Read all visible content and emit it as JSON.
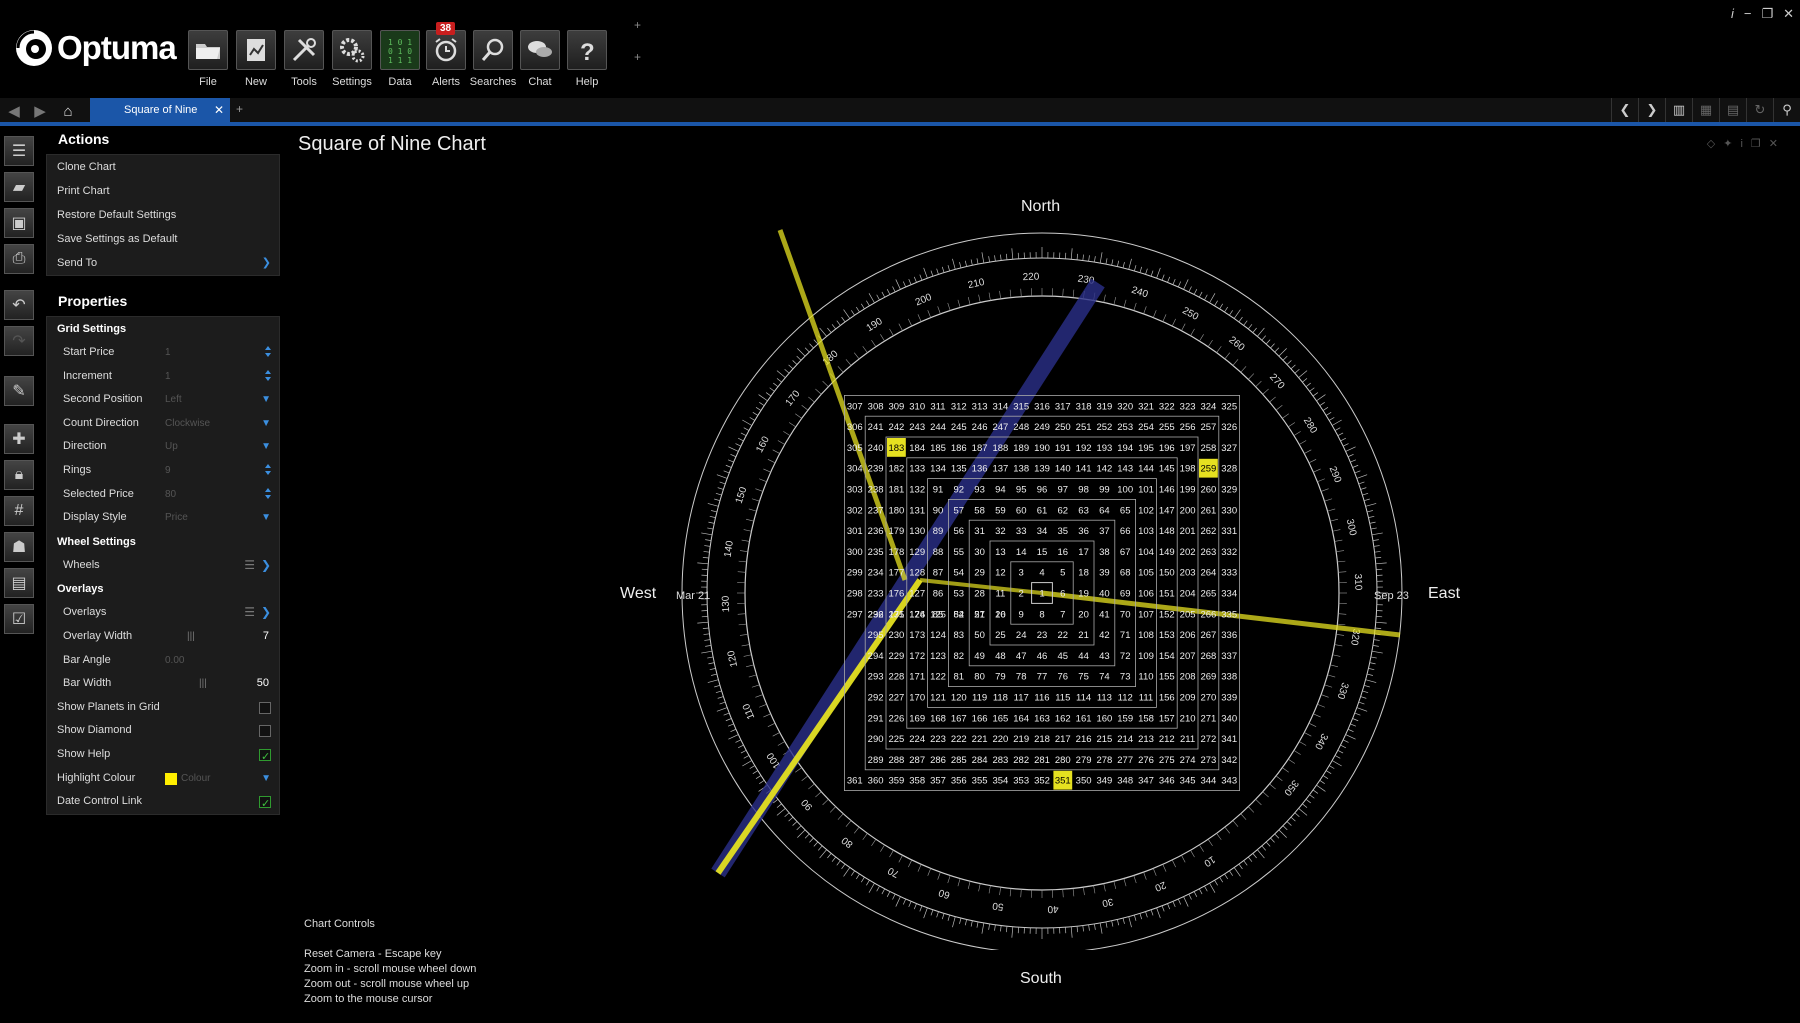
{
  "app": {
    "brand": "Optuma",
    "toolbar": [
      {
        "label": "File",
        "icon": "folder-icon"
      },
      {
        "label": "New",
        "icon": "new-chart-icon"
      },
      {
        "label": "Tools",
        "icon": "tools-icon"
      },
      {
        "label": "Settings",
        "icon": "gears-icon"
      },
      {
        "label": "Data",
        "icon": "data-icon"
      },
      {
        "label": "Alerts",
        "icon": "alarm-clock-icon"
      },
      {
        "label": "Searches",
        "icon": "magnifier-icon"
      },
      {
        "label": "Chat",
        "icon": "chat-bubbles-icon"
      },
      {
        "label": "Help",
        "icon": "question-icon"
      }
    ],
    "alerts_count": "38"
  },
  "tabs": [
    {
      "label": "Square of Nine",
      "active": true
    }
  ],
  "panel": {
    "actions_title": "Actions",
    "actions": [
      "Clone Chart",
      "Print Chart",
      "Restore Default Settings",
      "Save Settings as Default",
      "Send To"
    ],
    "properties_title": "Properties",
    "grid_settings": "Grid Settings",
    "start_price": {
      "label": "Start Price",
      "value": "1"
    },
    "increment": {
      "label": "Increment",
      "value": "1"
    },
    "second_position": {
      "label": "Second Position",
      "value": "Left"
    },
    "count_direction": {
      "label": "Count Direction",
      "value": "Clockwise"
    },
    "direction": {
      "label": "Direction",
      "value": "Up"
    },
    "rings": {
      "label": "Rings",
      "value": "9"
    },
    "selected_price": {
      "label": "Selected Price",
      "value": "80"
    },
    "display_style": {
      "label": "Display Style",
      "value": "Price"
    },
    "wheel_settings": "Wheel Settings",
    "wheels": {
      "label": "Wheels"
    },
    "overlays_group": "Overlays",
    "overlays": {
      "label": "Overlays"
    },
    "overlay_width": {
      "label": "Overlay Width",
      "value": "7"
    },
    "bar_angle": {
      "label": "Bar Angle",
      "value": "0.00"
    },
    "bar_width": {
      "label": "Bar Width",
      "value": "50"
    },
    "show_planets": {
      "label": "Show Planets in Grid",
      "checked": false
    },
    "show_diamond": {
      "label": "Show Diamond",
      "checked": false
    },
    "show_help": {
      "label": "Show Help",
      "checked": true
    },
    "highlight_colour": {
      "label": "Highlight Colour",
      "value": "Colour",
      "color": "#ffee00"
    },
    "date_control_link": {
      "label": "Date Control Link",
      "checked": true
    }
  },
  "chart": {
    "title": "Square of Nine Chart",
    "north": "North",
    "south": "South",
    "east": "East",
    "west": "West",
    "degree_labels": [
      "10",
      "20",
      "30",
      "40",
      "50",
      "60",
      "70",
      "80",
      "90",
      "100",
      "110",
      "120",
      "130",
      "140",
      "150",
      "160",
      "170",
      "180",
      "190",
      "200",
      "210",
      "220",
      "230",
      "240",
      "250",
      "260",
      "270",
      "280",
      "290",
      "300",
      "310",
      "320",
      "330",
      "340",
      "350"
    ],
    "date_labels": {
      "mar": "Mar 21",
      "sep": "Sep 23"
    },
    "grid_highlights": [
      183,
      259,
      351
    ],
    "highlight_color": "#e5e020",
    "overlay_color": "#2a2f8a",
    "rings": 9
  },
  "help": {
    "title": "Chart Controls",
    "lines": [
      "Reset Camera - Escape key",
      "Zoom in - scroll mouse wheel down",
      "Zoom out - scroll mouse wheel up",
      "Zoom to the mouse cursor"
    ]
  }
}
